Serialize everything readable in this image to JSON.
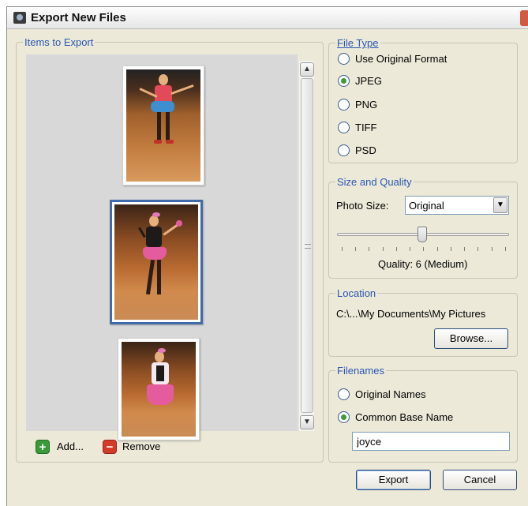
{
  "window": {
    "title": "Export New Files"
  },
  "items_panel": {
    "legend": "Items to Export",
    "add_label": "Add...",
    "remove_label": "Remove"
  },
  "file_type": {
    "legend": "File Type",
    "options": [
      "Use Original Format",
      "JPEG",
      "PNG",
      "TIFF",
      "PSD"
    ],
    "selected": "JPEG"
  },
  "size_quality": {
    "legend": "Size and Quality",
    "photo_size_label": "Photo Size:",
    "photo_size_value": "Original",
    "quality_text": "Quality: 6 (Medium)",
    "quality_level": 6
  },
  "location": {
    "legend": "Location",
    "path": "C:\\...\\My Documents\\My Pictures",
    "browse_label": "Browse..."
  },
  "filenames": {
    "legend": "Filenames",
    "options": [
      "Original Names",
      "Common Base Name"
    ],
    "selected": "Common Base Name",
    "base_name": "joyce"
  },
  "buttons": {
    "export": "Export",
    "cancel": "Cancel"
  },
  "colors": {
    "legend": "#2a58b4",
    "selection": "#3f6bab",
    "dialog_bg": "#ece9d8"
  }
}
